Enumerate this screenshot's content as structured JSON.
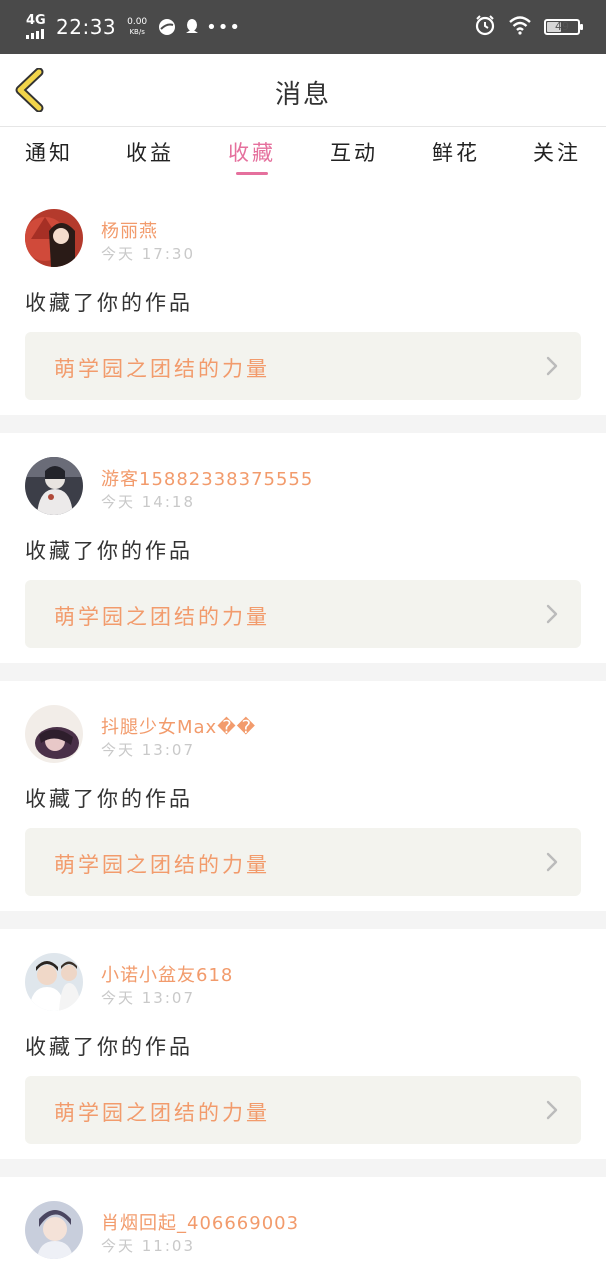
{
  "status_bar": {
    "network": "4G",
    "time": "22:33",
    "speed_value": "0.00",
    "speed_unit": "KB/s",
    "battery_level": "49",
    "icons": [
      "signal-icon",
      "browser-icon",
      "qq-icon",
      "more-dots-icon",
      "alarm-icon",
      "wifi-icon",
      "battery-icon"
    ]
  },
  "header": {
    "title": "消息",
    "back_icon": "chevron-left-icon"
  },
  "tabs": [
    {
      "label": "通知",
      "active": false
    },
    {
      "label": "收益",
      "active": false
    },
    {
      "label": "收藏",
      "active": true
    },
    {
      "label": "互动",
      "active": false
    },
    {
      "label": "鲜花",
      "active": false
    },
    {
      "label": "关注",
      "active": false
    }
  ],
  "notifications": [
    {
      "user": "杨丽燕",
      "time": "今天 17:30",
      "action": "收藏了你的作品",
      "work": "萌学园之团结的力量"
    },
    {
      "user": "游客15882338375555",
      "time": "今天 14:18",
      "action": "收藏了你的作品",
      "work": "萌学园之团结的力量"
    },
    {
      "user": "抖腿少女Max��",
      "time": "今天 13:07",
      "action": "收藏了你的作品",
      "work": "萌学园之团结的力量"
    },
    {
      "user": "小诺小盆友618",
      "time": "今天 13:07",
      "action": "收藏了你的作品",
      "work": "萌学园之团结的力量"
    },
    {
      "user": "肖烟回起_406669003",
      "time": "今天 11:03",
      "action": "",
      "work": ""
    }
  ],
  "colors": {
    "accent": "#e5709d",
    "username": "#f29b6c",
    "work_bg": "#f3f3ee",
    "status_bar": "#4a4a4a"
  }
}
